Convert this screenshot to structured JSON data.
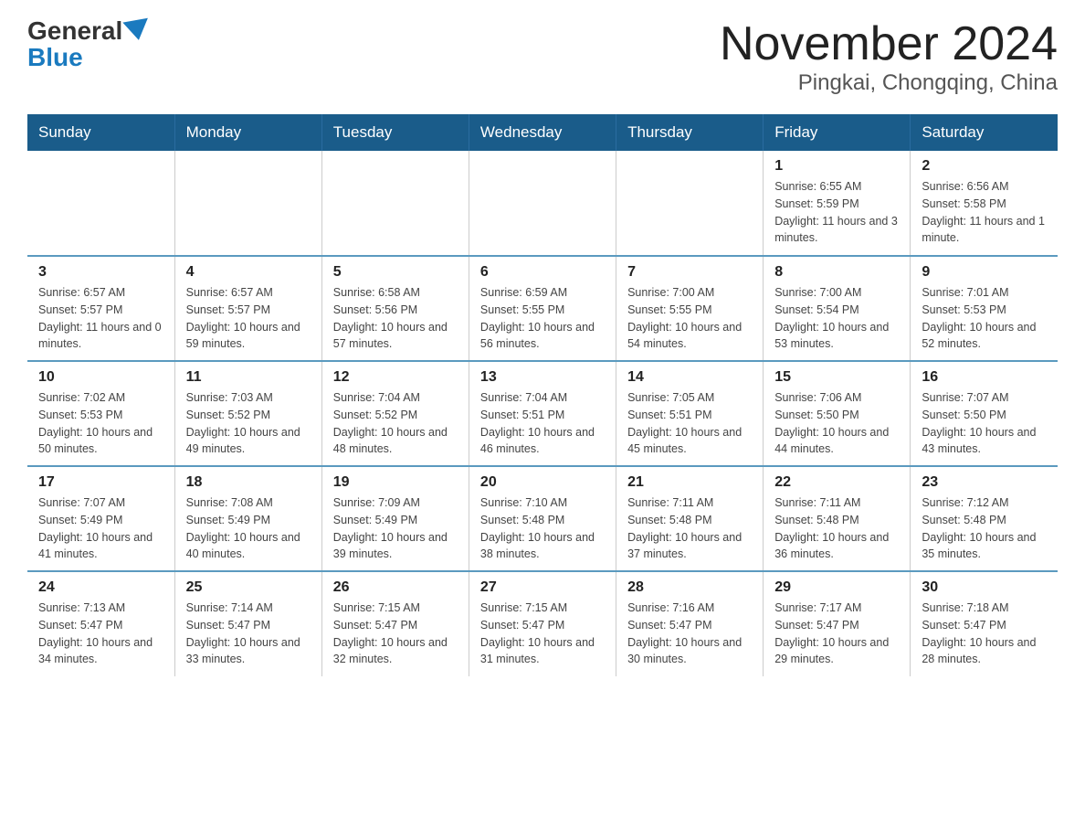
{
  "logo": {
    "general": "General",
    "blue": "Blue"
  },
  "header": {
    "title": "November 2024",
    "subtitle": "Pingkai, Chongqing, China"
  },
  "weekdays": [
    "Sunday",
    "Monday",
    "Tuesday",
    "Wednesday",
    "Thursday",
    "Friday",
    "Saturday"
  ],
  "weeks": [
    [
      {
        "day": "",
        "info": ""
      },
      {
        "day": "",
        "info": ""
      },
      {
        "day": "",
        "info": ""
      },
      {
        "day": "",
        "info": ""
      },
      {
        "day": "",
        "info": ""
      },
      {
        "day": "1",
        "info": "Sunrise: 6:55 AM\nSunset: 5:59 PM\nDaylight: 11 hours and 3 minutes."
      },
      {
        "day": "2",
        "info": "Sunrise: 6:56 AM\nSunset: 5:58 PM\nDaylight: 11 hours and 1 minute."
      }
    ],
    [
      {
        "day": "3",
        "info": "Sunrise: 6:57 AM\nSunset: 5:57 PM\nDaylight: 11 hours and 0 minutes."
      },
      {
        "day": "4",
        "info": "Sunrise: 6:57 AM\nSunset: 5:57 PM\nDaylight: 10 hours and 59 minutes."
      },
      {
        "day": "5",
        "info": "Sunrise: 6:58 AM\nSunset: 5:56 PM\nDaylight: 10 hours and 57 minutes."
      },
      {
        "day": "6",
        "info": "Sunrise: 6:59 AM\nSunset: 5:55 PM\nDaylight: 10 hours and 56 minutes."
      },
      {
        "day": "7",
        "info": "Sunrise: 7:00 AM\nSunset: 5:55 PM\nDaylight: 10 hours and 54 minutes."
      },
      {
        "day": "8",
        "info": "Sunrise: 7:00 AM\nSunset: 5:54 PM\nDaylight: 10 hours and 53 minutes."
      },
      {
        "day": "9",
        "info": "Sunrise: 7:01 AM\nSunset: 5:53 PM\nDaylight: 10 hours and 52 minutes."
      }
    ],
    [
      {
        "day": "10",
        "info": "Sunrise: 7:02 AM\nSunset: 5:53 PM\nDaylight: 10 hours and 50 minutes."
      },
      {
        "day": "11",
        "info": "Sunrise: 7:03 AM\nSunset: 5:52 PM\nDaylight: 10 hours and 49 minutes."
      },
      {
        "day": "12",
        "info": "Sunrise: 7:04 AM\nSunset: 5:52 PM\nDaylight: 10 hours and 48 minutes."
      },
      {
        "day": "13",
        "info": "Sunrise: 7:04 AM\nSunset: 5:51 PM\nDaylight: 10 hours and 46 minutes."
      },
      {
        "day": "14",
        "info": "Sunrise: 7:05 AM\nSunset: 5:51 PM\nDaylight: 10 hours and 45 minutes."
      },
      {
        "day": "15",
        "info": "Sunrise: 7:06 AM\nSunset: 5:50 PM\nDaylight: 10 hours and 44 minutes."
      },
      {
        "day": "16",
        "info": "Sunrise: 7:07 AM\nSunset: 5:50 PM\nDaylight: 10 hours and 43 minutes."
      }
    ],
    [
      {
        "day": "17",
        "info": "Sunrise: 7:07 AM\nSunset: 5:49 PM\nDaylight: 10 hours and 41 minutes."
      },
      {
        "day": "18",
        "info": "Sunrise: 7:08 AM\nSunset: 5:49 PM\nDaylight: 10 hours and 40 minutes."
      },
      {
        "day": "19",
        "info": "Sunrise: 7:09 AM\nSunset: 5:49 PM\nDaylight: 10 hours and 39 minutes."
      },
      {
        "day": "20",
        "info": "Sunrise: 7:10 AM\nSunset: 5:48 PM\nDaylight: 10 hours and 38 minutes."
      },
      {
        "day": "21",
        "info": "Sunrise: 7:11 AM\nSunset: 5:48 PM\nDaylight: 10 hours and 37 minutes."
      },
      {
        "day": "22",
        "info": "Sunrise: 7:11 AM\nSunset: 5:48 PM\nDaylight: 10 hours and 36 minutes."
      },
      {
        "day": "23",
        "info": "Sunrise: 7:12 AM\nSunset: 5:48 PM\nDaylight: 10 hours and 35 minutes."
      }
    ],
    [
      {
        "day": "24",
        "info": "Sunrise: 7:13 AM\nSunset: 5:47 PM\nDaylight: 10 hours and 34 minutes."
      },
      {
        "day": "25",
        "info": "Sunrise: 7:14 AM\nSunset: 5:47 PM\nDaylight: 10 hours and 33 minutes."
      },
      {
        "day": "26",
        "info": "Sunrise: 7:15 AM\nSunset: 5:47 PM\nDaylight: 10 hours and 32 minutes."
      },
      {
        "day": "27",
        "info": "Sunrise: 7:15 AM\nSunset: 5:47 PM\nDaylight: 10 hours and 31 minutes."
      },
      {
        "day": "28",
        "info": "Sunrise: 7:16 AM\nSunset: 5:47 PM\nDaylight: 10 hours and 30 minutes."
      },
      {
        "day": "29",
        "info": "Sunrise: 7:17 AM\nSunset: 5:47 PM\nDaylight: 10 hours and 29 minutes."
      },
      {
        "day": "30",
        "info": "Sunrise: 7:18 AM\nSunset: 5:47 PM\nDaylight: 10 hours and 28 minutes."
      }
    ]
  ]
}
